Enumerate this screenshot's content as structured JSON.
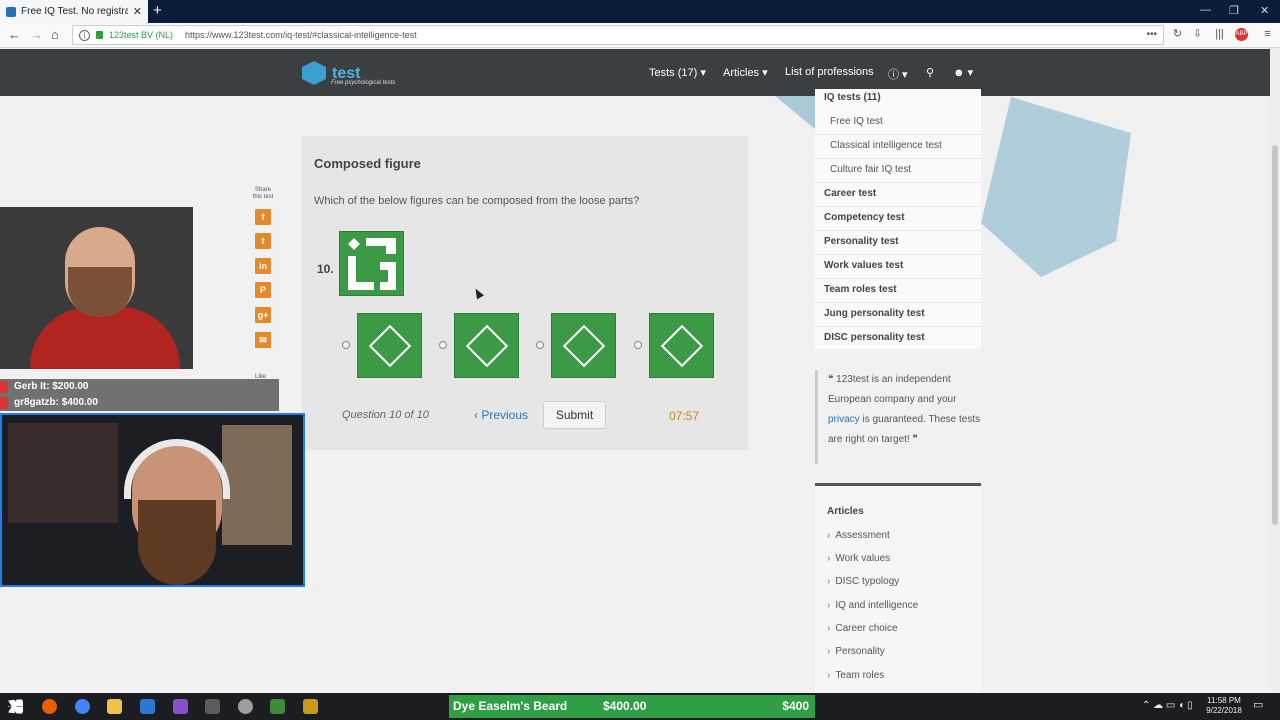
{
  "browser": {
    "tab_title": "Free IQ Test. No registration, te",
    "url_identity": "123test BV (NL)",
    "url": "https://www.123test.com/iq-test/#classical-intelligence-test"
  },
  "site": {
    "logo_text": "test",
    "logo_sub": "Free psychological tests",
    "nav": [
      "Tests (17) ▾",
      "Articles ▾",
      "List of professions",
      "ⓘ ▾",
      "⚲",
      "☻ ▾"
    ]
  },
  "share": {
    "label": "Share this test",
    "like_label": "Like",
    "buttons": [
      "f",
      "t",
      "in",
      "P",
      "g+",
      "✉"
    ]
  },
  "test": {
    "title": "Composed figure",
    "question": "Which of the below figures can be composed from the loose parts?",
    "number": "10.",
    "progress": "Question 10 of 10",
    "previous": "‹ Previous",
    "submit": "Submit",
    "timer": "07:57"
  },
  "right_menu": {
    "header": "IQ tests (11)",
    "sub_items": [
      "Free IQ test",
      "Classical intelligence test",
      "Culture fair IQ test"
    ],
    "items": [
      "Career test",
      "Competency test",
      "Personality test",
      "Work values test",
      "Team roles test",
      "Jung personality test",
      "DISC personality test"
    ]
  },
  "quote": {
    "part1": "❝ 123test is an independent European company and your ",
    "link": "privacy",
    "part2": " is guaranteed. These tests are right on target! ❞"
  },
  "articles": {
    "title": "Articles",
    "items": [
      "Assessment",
      "Work values",
      "DISC typology",
      "IQ and intelligence",
      "Career choice",
      "Personality",
      "Team roles"
    ]
  },
  "stream": {
    "donations": [
      "Gerb It: $200.00",
      "gr8gatzb: $400.00"
    ],
    "ticker_name": "Dye Easelm's Beard",
    "ticker_amount": "$400.00",
    "ticker_goal": "$400"
  },
  "taskbar": {
    "time": "11:58 PM",
    "date": "9/22/2018"
  }
}
